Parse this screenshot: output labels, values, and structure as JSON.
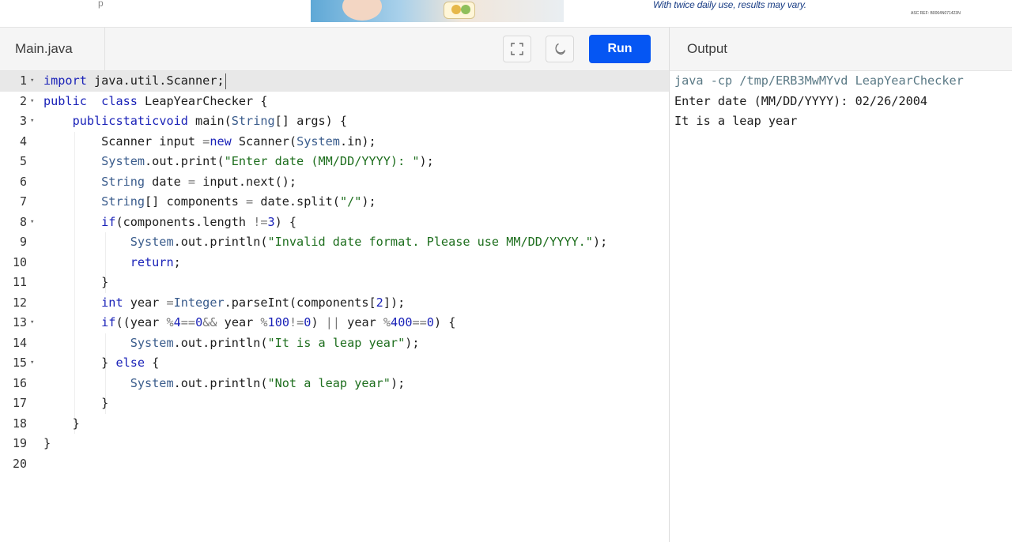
{
  "ad": {
    "left_mark": "p",
    "tagline": "With twice daily use, results may vary.",
    "ref": "ASC REF: B0064N071423N"
  },
  "editor": {
    "file_name": "Main.java",
    "run_label": "Run",
    "lines": [
      {
        "num": "1",
        "fold": true
      },
      {
        "num": "2",
        "fold": true
      },
      {
        "num": "3",
        "fold": true
      },
      {
        "num": "4",
        "fold": false
      },
      {
        "num": "5",
        "fold": false
      },
      {
        "num": "6",
        "fold": false
      },
      {
        "num": "7",
        "fold": false
      },
      {
        "num": "8",
        "fold": true
      },
      {
        "num": "9",
        "fold": false
      },
      {
        "num": "10",
        "fold": false
      },
      {
        "num": "11",
        "fold": false
      },
      {
        "num": "12",
        "fold": false
      },
      {
        "num": "13",
        "fold": true
      },
      {
        "num": "14",
        "fold": false
      },
      {
        "num": "15",
        "fold": true
      },
      {
        "num": "16",
        "fold": false
      },
      {
        "num": "17",
        "fold": false
      },
      {
        "num": "18",
        "fold": false
      },
      {
        "num": "19",
        "fold": false
      },
      {
        "num": "20",
        "fold": false
      }
    ],
    "code": [
      [
        [
          "k",
          "import"
        ],
        [
          "",
          "java.util.Scanner;"
        ]
      ],
      [
        [
          "k",
          "public"
        ],
        [
          "",
          "&nbsp;"
        ],
        [
          "k",
          "class"
        ],
        [
          "",
          "LeapYearChecker {"
        ]
      ],
      [
        [
          "",
          "    "
        ],
        [
          "k",
          "public"
        ],
        [
          "",
          ""
        ],
        [
          "k",
          "static"
        ],
        [
          "",
          ""
        ],
        [
          "k",
          "void"
        ],
        [
          "",
          "main("
        ],
        [
          "t",
          "String"
        ],
        [
          "",
          "[] args) {"
        ]
      ],
      [
        [
          "",
          "        Scanner input "
        ],
        [
          "o",
          "="
        ],
        [
          "",
          ""
        ],
        [
          "k",
          "new"
        ],
        [
          "",
          "Scanner("
        ],
        [
          "t",
          "System"
        ],
        [
          "",
          ".in);"
        ]
      ],
      [
        [
          "",
          "        "
        ],
        [
          "t",
          "System"
        ],
        [
          "",
          ".out.print("
        ],
        [
          "s",
          "\"Enter date (MM/DD/YYYY): \""
        ],
        [
          "",
          ");"
        ]
      ],
      [
        [
          "",
          "        "
        ],
        [
          "t",
          "String"
        ],
        [
          "",
          "date "
        ],
        [
          "o",
          "="
        ],
        [
          "",
          "input.next();"
        ]
      ],
      [
        [
          "",
          "        "
        ],
        [
          "t",
          "String"
        ],
        [
          "",
          "[] components "
        ],
        [
          "o",
          "="
        ],
        [
          "",
          "date.split("
        ],
        [
          "s",
          "\"/\""
        ],
        [
          "",
          ");"
        ]
      ],
      [
        [
          "",
          "        "
        ],
        [
          "k",
          "if"
        ],
        [
          "",
          "(components.length "
        ],
        [
          "o",
          "!="
        ],
        [
          "",
          ""
        ],
        [
          "n",
          "3"
        ],
        [
          "",
          ") {"
        ]
      ],
      [
        [
          "",
          "            "
        ],
        [
          "t",
          "System"
        ],
        [
          "",
          ".out.println("
        ],
        [
          "s",
          "\"Invalid date format. Please use MM/DD/YYYY.\""
        ],
        [
          "",
          ");"
        ]
      ],
      [
        [
          "",
          "            "
        ],
        [
          "k",
          "return"
        ],
        [
          "",
          ";"
        ]
      ],
      [
        [
          "",
          "        }"
        ]
      ],
      [
        [
          "",
          "        "
        ],
        [
          "k",
          "int"
        ],
        [
          "",
          "year "
        ],
        [
          "o",
          "="
        ],
        [
          "",
          ""
        ],
        [
          "t",
          "Integer"
        ],
        [
          "",
          ".parseInt(components["
        ],
        [
          "n",
          "2"
        ],
        [
          "",
          "]);"
        ]
      ],
      [
        [
          "",
          "        "
        ],
        [
          "k",
          "if"
        ],
        [
          "",
          "((year "
        ],
        [
          "o",
          "%"
        ],
        [
          "",
          ""
        ],
        [
          "n",
          "4"
        ],
        [
          "",
          ""
        ],
        [
          "o",
          "=="
        ],
        [
          "",
          ""
        ],
        [
          "n",
          "0"
        ],
        [
          "",
          ""
        ],
        [
          "o",
          "&&"
        ],
        [
          "",
          "year "
        ],
        [
          "o",
          "%"
        ],
        [
          "",
          ""
        ],
        [
          "n",
          "100"
        ],
        [
          "",
          ""
        ],
        [
          "o",
          "!="
        ],
        [
          "",
          ""
        ],
        [
          "n",
          "0"
        ],
        [
          "",
          ") "
        ],
        [
          "o",
          "||"
        ],
        [
          "",
          "year "
        ],
        [
          "o",
          "%"
        ],
        [
          "",
          ""
        ],
        [
          "n",
          "400"
        ],
        [
          "",
          ""
        ],
        [
          "o",
          "=="
        ],
        [
          "",
          ""
        ],
        [
          "n",
          "0"
        ],
        [
          "",
          ") {"
        ]
      ],
      [
        [
          "",
          "            "
        ],
        [
          "t",
          "System"
        ],
        [
          "",
          ".out.println("
        ],
        [
          "s",
          "\"It is a leap year\""
        ],
        [
          "",
          ");"
        ]
      ],
      [
        [
          "",
          "        } "
        ],
        [
          "k",
          "else"
        ],
        [
          "",
          "{"
        ]
      ],
      [
        [
          "",
          "            "
        ],
        [
          "t",
          "System"
        ],
        [
          "",
          ".out.println("
        ],
        [
          "s",
          "\"Not a leap year\""
        ],
        [
          "",
          ");"
        ]
      ],
      [
        [
          "",
          "        }"
        ]
      ],
      [
        [
          "",
          "    }"
        ]
      ],
      [
        [
          "",
          "}"
        ]
      ],
      [
        [
          "",
          ""
        ]
      ]
    ]
  },
  "output": {
    "title": "Output",
    "command": "java -cp /tmp/ERB3MwMYvd LeapYearChecker",
    "lines": [
      "Enter date (MM/DD/YYYY): 02/26/2004",
      "It is a leap year"
    ]
  },
  "colors": {
    "run_button": "#0556f3",
    "keyword": "#1a22b8",
    "string": "#1d6e1d",
    "type": "#3a5c8c"
  }
}
